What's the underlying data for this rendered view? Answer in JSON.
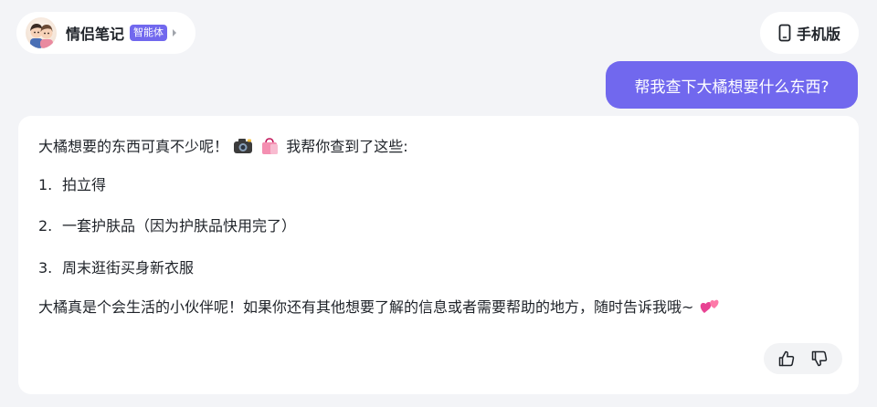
{
  "header": {
    "agent_name": "情侣笔记",
    "agent_badge": "智能体",
    "mobile_label": "手机版"
  },
  "user_message": "帮我查下大橘想要什么东西?",
  "reply": {
    "intro": "大橘想要的东西可真不少呢！",
    "intro_tail": "我帮你查到了这些:",
    "items": [
      {
        "num": "1.",
        "text": "拍立得"
      },
      {
        "num": "2.",
        "text": "一套护肤品（因为护肤品快用完了）"
      },
      {
        "num": "3.",
        "text": "周末逛街买身新衣服"
      }
    ],
    "closing": "大橘真是个会生活的小伙伴呢！如果你还有其他想要了解的信息或者需要帮助的地方，随时告诉我哦~"
  },
  "icons": {
    "avatar": "couple-avatar",
    "chevron": "chevron-right-icon",
    "mobile": "phone-icon",
    "camera": "camera-emoji",
    "bag": "shopping-bag-emoji",
    "hearts": "two-hearts-emoji",
    "like": "thumbs-up-icon",
    "dislike": "thumbs-down-icon"
  },
  "colors": {
    "accent": "#7168ee",
    "background": "#f3f4f7",
    "card": "#ffffff"
  }
}
